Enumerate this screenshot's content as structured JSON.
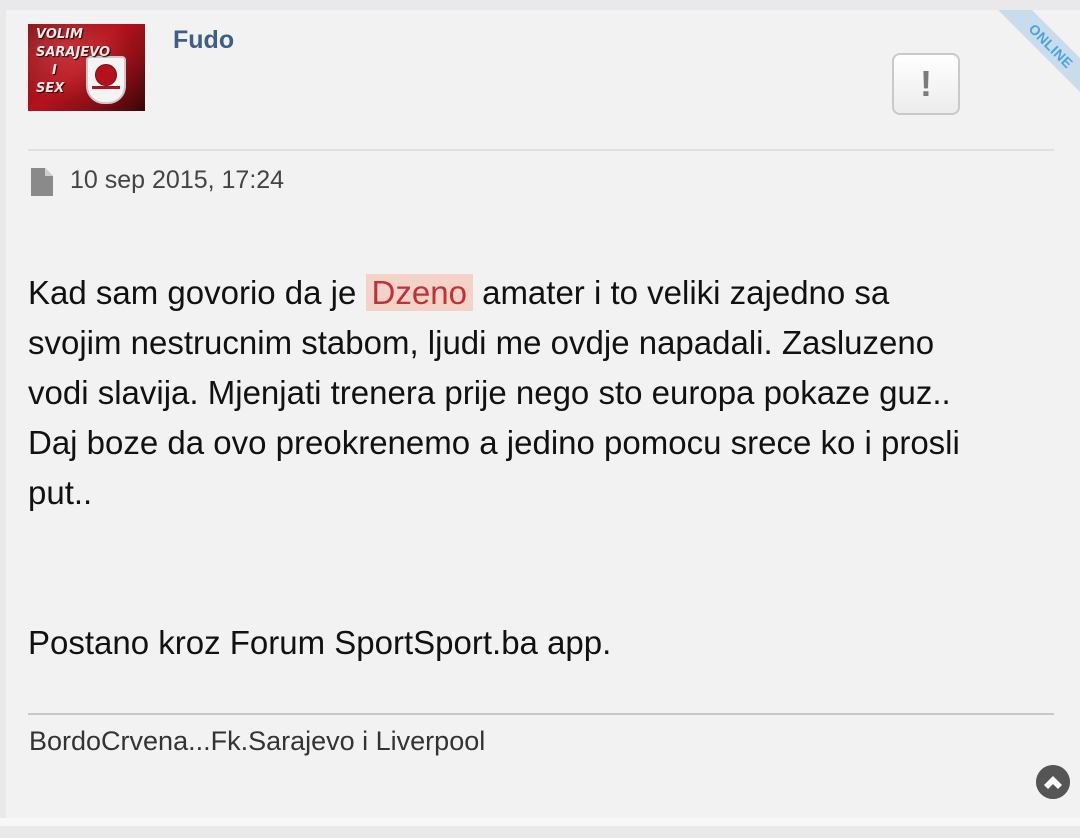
{
  "post": {
    "author": {
      "username": "Fudo",
      "avatar_text_lines": [
        "VOLIM",
        "SARAJEVO",
        "I",
        "SEX"
      ],
      "online_label": "ONLINE"
    },
    "report_button": {
      "icon": "exclamation-icon",
      "label": "!"
    },
    "date": "10 sep 2015, 17:24",
    "content": {
      "line1_before": "Kad sam govorio da je ",
      "mention": "Dzeno",
      "line1_after": " amater i to veliki zajedno sa",
      "line2": "svojim nestrucnim stabom, ljudi me ovdje napadali. Zasluzeno",
      "line3": "vodi slavija. Mjenjati trenera prije nego sto europa pokaze guz..",
      "line4": "Daj boze da ovo preokrenemo a jedino pomocu srece ko i prosli",
      "line5": "put..",
      "app_note": "Postano kroz Forum SportSport.ba app."
    },
    "signature": "BordoCrvena...Fk.Sarajevo i Liverpool",
    "scroll_top_icon": "chevron-up-circle-icon"
  },
  "colors": {
    "username": "#3f5d86",
    "mention_bg": "#f3d2c8",
    "mention_text": "#c2303a",
    "online": "#4aa3e0",
    "post_bg": "#f2f2f2"
  }
}
